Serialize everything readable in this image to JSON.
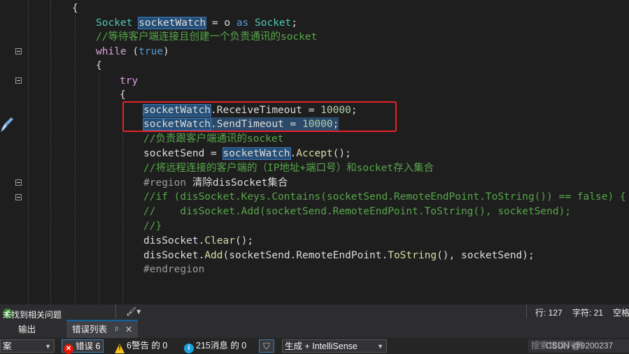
{
  "code_lines": {
    "l1": "{",
    "l2_type1": "Socket",
    "l2_var": "socketWatch",
    "l2_mid": " = o ",
    "l2_as": "as",
    "l2_type2": "Socket",
    "l2_end": ";",
    "l3": "//等待客户端连接且创建一个负责通讯的socket",
    "l4_kw": "while",
    "l4_open": " (",
    "l4_true": "true",
    "l4_close": ")",
    "l5": "{",
    "l6": "try",
    "l7": "{",
    "l8_var": "socketWatch",
    "l8_rest": ".ReceiveTimeout = ",
    "l8_num": "10000",
    "l8_end": ";",
    "l9_var": "socketWatch",
    "l9_rest": ".SendTimeout = ",
    "l9_num": "10000",
    "l9_end": ";",
    "l10": "//负责跟客户端通讯的socket",
    "l11_a": "socketSend = ",
    "l11_var": "socketWatch",
    "l11_dot": ".",
    "l11_m": "Accept",
    "l11_end": "();",
    "l12": "//将远程连接的客户端的（IP地址+端口号）和socket存入集合",
    "l13_kw": "#region",
    "l13_name": " 清除disSocket集合",
    "l14": "//if (disSocket.Keys.Contains(socketSend.RemoteEndPoint.ToString()) == false) {",
    "l15": "//    disSocket.Add(socketSend.RemoteEndPoint.ToString(), socketSend);",
    "l16": "//}",
    "l17_a": "disSocket.",
    "l17_m": "Clear",
    "l17_end": "();",
    "l18_a": "disSocket.",
    "l18_m": "Add",
    "l18_b": "(socketSend.RemoteEndPoint.",
    "l18_m2": "ToString",
    "l18_end": "(), socketSend);",
    "l19": "#endregion"
  },
  "status": {
    "issues": "未找到相关问题",
    "row": "行: 127",
    "col": "字符: 21",
    "space": "空格"
  },
  "tabs": {
    "output": "输出",
    "errorlist": "错误列表",
    "pin": "ᵖ",
    "close": "✕"
  },
  "toolbar": {
    "scope": "案",
    "errors": "错误 6",
    "warnings": "6警告 的 0",
    "messages": "215消息 的 0",
    "build": "生成 + IntelliSense",
    "search": "搜索错误列表",
    "watermark": "CSDN @9200237"
  },
  "colors": {
    "error": "#e51400",
    "warning": "#fcc21b",
    "info": "#1ba1e2",
    "highlight_box": "#e8202a"
  }
}
